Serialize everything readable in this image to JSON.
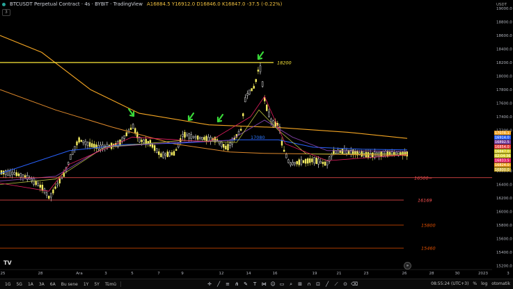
{
  "header": {
    "symbol": "BTCUSDT Perpetual Contract · 4s · BYBIT · TradingView",
    "open_label": "A",
    "open": "16884.5",
    "high_label": "Y",
    "high": "16912.0",
    "low_label": "D",
    "low": "16846.0",
    "close_label": "K",
    "close": "16847.0",
    "change": "-37.5 (-0.22%)",
    "collapse_label": "3"
  },
  "price_axis": {
    "currency": "USDT",
    "ticks": [
      "19000.0",
      "18800.0",
      "18600.0",
      "18400.0",
      "18200.0",
      "18000.0",
      "17800.0",
      "17600.0",
      "17400.0",
      "17200.0",
      "16600.0",
      "16400.0",
      "16200.0",
      "16000.0",
      "15800.0",
      "15600.0",
      "15400.0",
      "15200.0"
    ],
    "badges": [
      {
        "text": "17078.1",
        "color": "#f5a623"
      },
      {
        "text": "16914.0",
        "color": "#2962ff"
      },
      {
        "text": "16892.5",
        "color": "#7b3fa0"
      },
      {
        "text": "16854.0",
        "color": "#e53935"
      },
      {
        "text": "16847.0",
        "color": "#d8d02a"
      },
      {
        "text": "02:04:36",
        "color": "#d8d02a"
      },
      {
        "text": "16833.5",
        "color": "#e91e63"
      },
      {
        "text": "16824.0",
        "color": "#f5a623"
      },
      {
        "text": "16800.0",
        "color": "#c8a82a"
      }
    ]
  },
  "time_axis": {
    "ticks": [
      "25",
      "28",
      "Ara",
      "3",
      "5",
      "7",
      "9",
      "12",
      "14",
      "16",
      "19",
      "21",
      "23",
      "26",
      "28",
      "30",
      "2023",
      "3"
    ]
  },
  "levels": [
    {
      "label": "18200",
      "price": 18200,
      "color": "#ffeb3b"
    },
    {
      "label": "16500~",
      "price": 16500,
      "color": "#ff5252"
    },
    {
      "label": "16169",
      "price": 16169,
      "color": "#ff5252"
    },
    {
      "label": "15800",
      "price": 15800,
      "color": "#e65100"
    },
    {
      "label": "15460",
      "price": 15460,
      "color": "#e65100"
    }
  ],
  "ma_label": "17080",
  "bottom": {
    "timeframes": [
      "1G",
      "5G",
      "1A",
      "3A",
      "6A",
      "Bu sene",
      "1Y",
      "5Y",
      "Tümü"
    ],
    "clock": "08:55:24 (UTC+3)",
    "percent": "%",
    "log": "log",
    "auto": "otomatik"
  },
  "tv_logo": "TV",
  "goto_label": "»"
}
